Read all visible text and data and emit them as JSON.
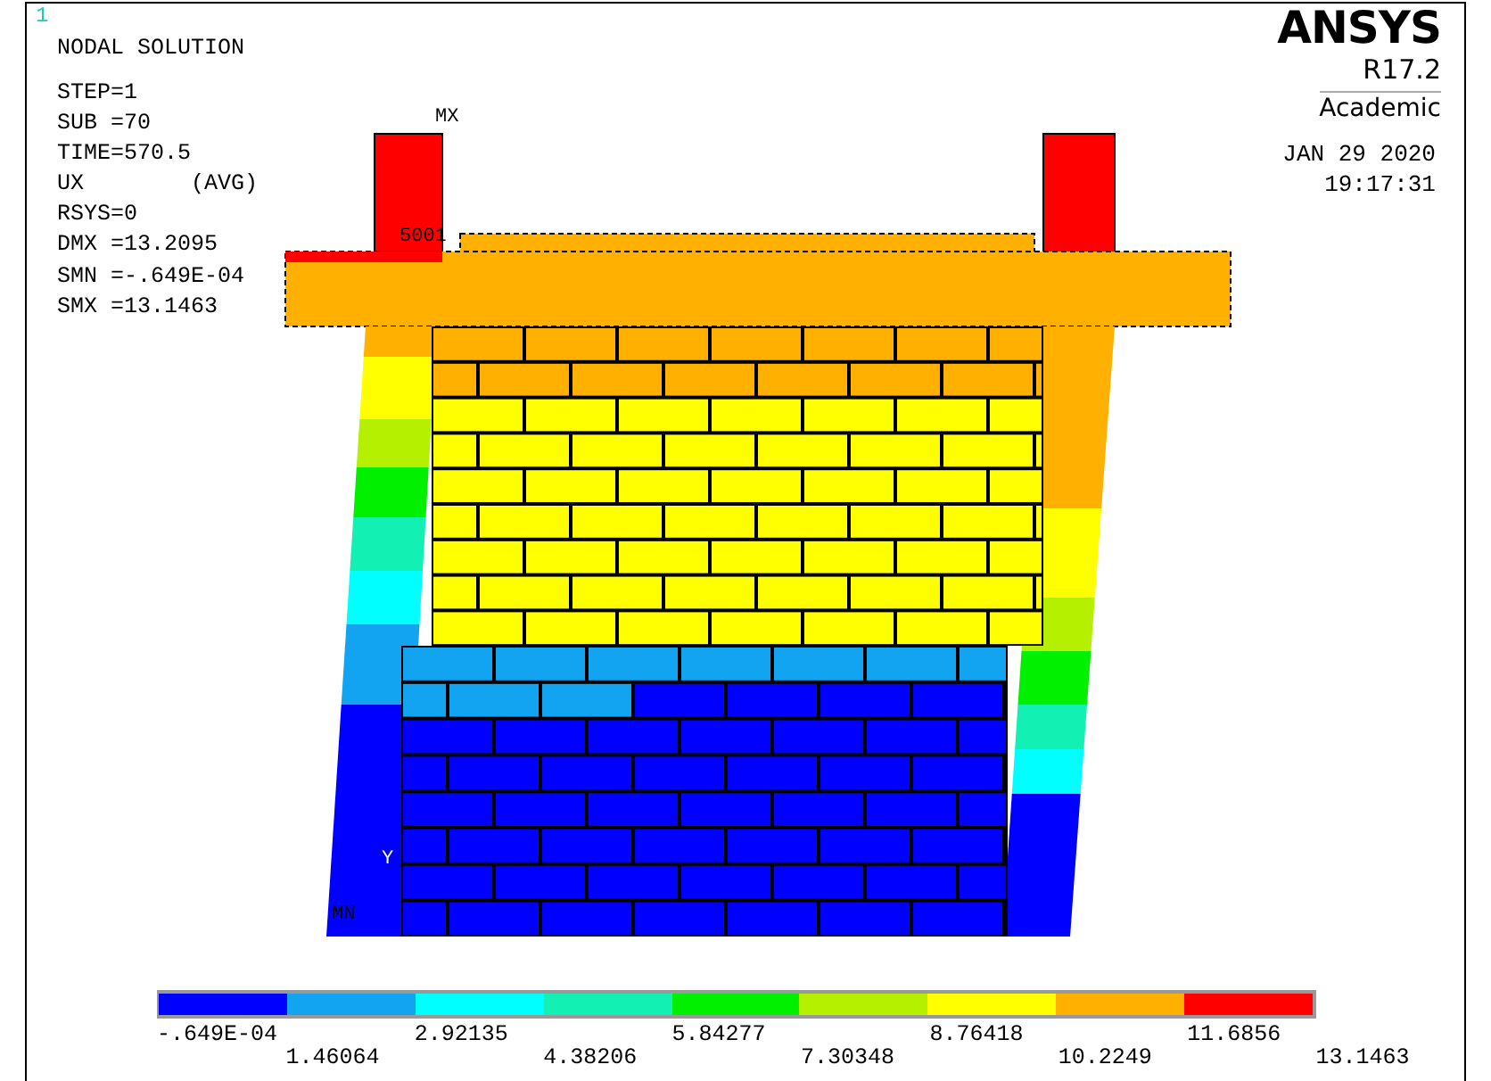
{
  "plot_number": "1",
  "title": "NODAL SOLUTION",
  "info_lines": [
    "STEP=1",
    "SUB =70",
    "TIME=570.5",
    "UX        (AVG)",
    "RSYS=0",
    "DMX =13.2095",
    "SMN =-.649E-04",
    "SMX =13.1463"
  ],
  "logo": {
    "brand": "ANSYS",
    "version": "R17.2",
    "edition": "Academic"
  },
  "date": "JAN 29 2020",
  "time": "19:17:31",
  "model_labels": [
    "MX",
    "5001",
    "Y",
    "MN"
  ],
  "legend": {
    "bands": [
      {
        "color": "#0000ff"
      },
      {
        "color": "#12a4f0"
      },
      {
        "color": "#00ffff"
      },
      {
        "color": "#12f0b4"
      },
      {
        "color": "#00f000"
      },
      {
        "color": "#b4f000"
      },
      {
        "color": "#ffff00"
      },
      {
        "color": "#ffb000"
      },
      {
        "color": "#ff0000"
      }
    ],
    "labels": [
      "-.649E-04",
      "1.46064",
      "2.92135",
      "4.38206",
      "5.84277",
      "7.30348",
      "8.76418",
      "10.2249",
      "11.6856",
      "13.1463"
    ]
  }
}
